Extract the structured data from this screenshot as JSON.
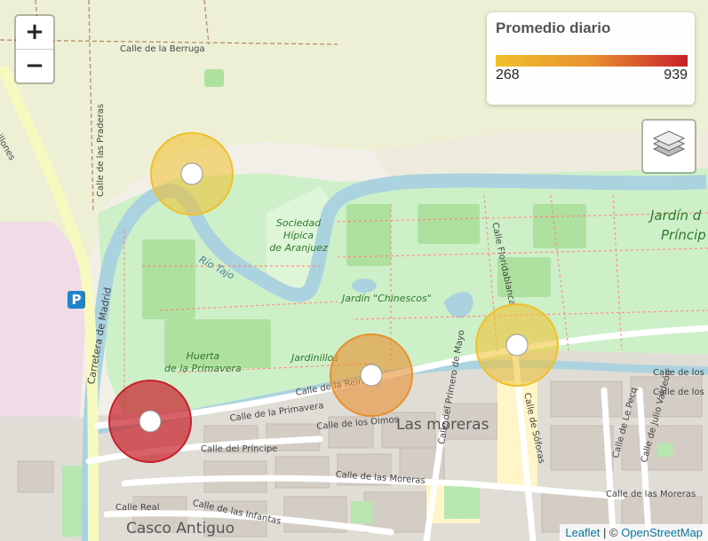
{
  "zoom": {
    "in_label": "+",
    "out_label": "−"
  },
  "legend": {
    "title": "Promedio diario",
    "min": "268",
    "max": "939",
    "gradient": [
      "#f0c02a",
      "#e89030",
      "#c8202a"
    ]
  },
  "layers_control": {
    "icon": "layers-icon"
  },
  "attribution": {
    "leaflet": "Leaflet",
    "separator": "| ©",
    "osm": "OpenStreetMap"
  },
  "map_labels": {
    "calle_berruga": "Calle de la Berruga",
    "chillones": "Chillones",
    "calle_praderas": "Calle de las Praderas",
    "sociedad_hipica": [
      "Sociedad",
      "Hípica",
      "de Aranjuez"
    ],
    "rio_tajo": "Río Tajo",
    "jardin_principe": [
      "Jardín d",
      "Príncip"
    ],
    "jardin_chinescos": "Jardín \"Chinescos\"",
    "calle_floridablanca": "Calle Floridablanca",
    "huerta_primavera": [
      "Huerta",
      "de la Primavera"
    ],
    "jardinillos": "Jardinillos",
    "carretera_madrid": "Carretera de Madrid",
    "calle_reina": "Calle de la Reina",
    "calle_primavera": "Calle de la Primavera",
    "calle_olmos": "Calle de los Olmos",
    "las_moreras": "Las moreras",
    "calle_principe": "Calle del Príncipe",
    "calle_las_moreras": "Calle de las Moreras",
    "calle_primero_mayo": "Calle del Primero de Mayo",
    "calle_real": "Calle Real",
    "calle_infantas": "Calle de las Infantas",
    "casco_antiguo": "Casco Antiguo",
    "calle_soforas": "Calle de Sóforas",
    "calle_le_pecq": "Calle de Le Pecq",
    "calle_julio_valdeon": "Calle de Julio Valdeón",
    "calle_moreras_right": "Calle de las Moreras",
    "calle_de_los_1": "Calle de los E",
    "calle_de_los_2": "Calle de los E",
    "parking": "P"
  },
  "stations": [
    {
      "name": "station-1",
      "color": "#f0c02a"
    },
    {
      "name": "station-2",
      "color": "#f0c02a"
    },
    {
      "name": "station-3",
      "color": "#e8902e"
    },
    {
      "name": "station-4",
      "color": "#c8202a"
    }
  ]
}
